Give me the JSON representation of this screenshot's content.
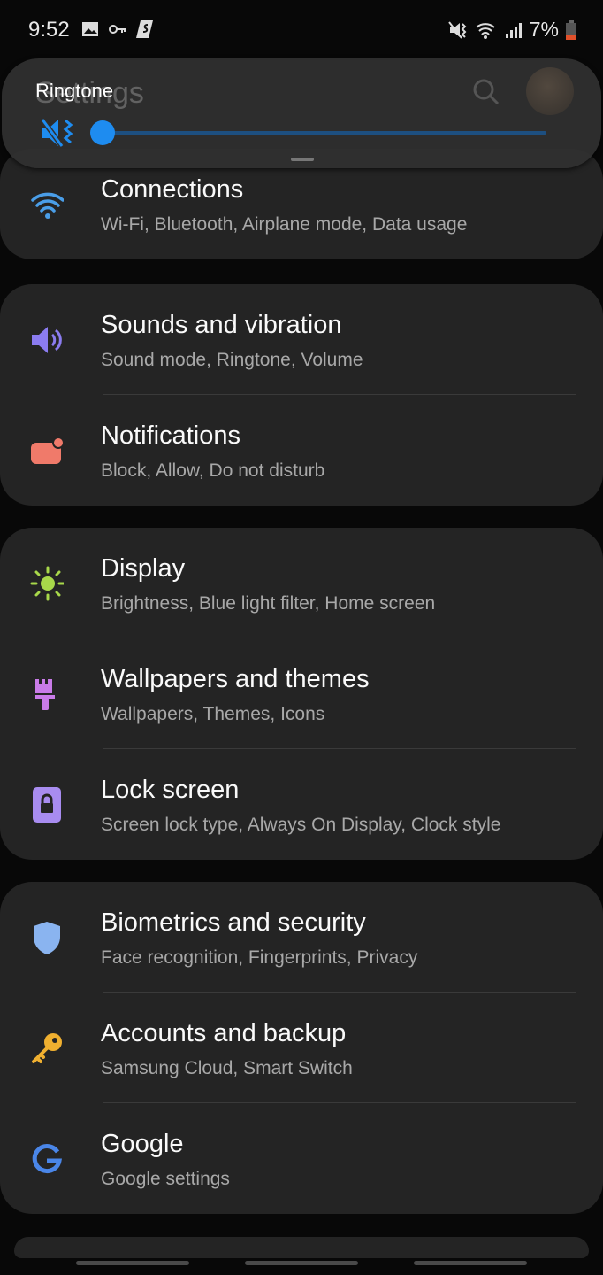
{
  "status_bar": {
    "time": "9:52",
    "battery": "7%",
    "icons": [
      "image-icon",
      "vpn-key-icon",
      "app-s-icon",
      "vibrate-mute-icon",
      "wifi-icon",
      "signal-icon",
      "battery-low-icon"
    ]
  },
  "header": {
    "title": "Settings",
    "icons": [
      "search-icon",
      "avatar"
    ]
  },
  "volume_panel": {
    "label": "Ringtone",
    "level_percent": 0,
    "icon": "vibrate-mute-icon",
    "accent": "#1e8cf0"
  },
  "groups": [
    {
      "items": [
        {
          "title": "Connections",
          "subtitle": "Wi-Fi, Bluetooth, Airplane mode, Data usage",
          "icon": "wifi-icon",
          "color": "#4a9ee8"
        }
      ]
    },
    {
      "items": [
        {
          "title": "Sounds and vibration",
          "subtitle": "Sound mode, Ringtone, Volume",
          "icon": "speaker-icon",
          "color": "#8b7cf0"
        },
        {
          "title": "Notifications",
          "subtitle": "Block, Allow, Do not disturb",
          "icon": "notification-icon",
          "color": "#f07a6a"
        }
      ]
    },
    {
      "items": [
        {
          "title": "Display",
          "subtitle": "Brightness, Blue light filter, Home screen",
          "icon": "sun-icon",
          "color": "#a8d84a"
        },
        {
          "title": "Wallpapers and themes",
          "subtitle": "Wallpapers, Themes, Icons",
          "icon": "brush-icon",
          "color": "#c97be8"
        },
        {
          "title": "Lock screen",
          "subtitle": "Screen lock type, Always On Display, Clock style",
          "icon": "lock-icon",
          "color": "#a88cf0"
        }
      ]
    },
    {
      "items": [
        {
          "title": "Biometrics and security",
          "subtitle": "Face recognition, Fingerprints, Privacy",
          "icon": "shield-icon",
          "color": "#8ab4f0"
        },
        {
          "title": "Accounts and backup",
          "subtitle": "Samsung Cloud, Smart Switch",
          "icon": "key-icon",
          "color": "#f0b030"
        },
        {
          "title": "Google",
          "subtitle": "Google settings",
          "icon": "google-icon",
          "color": "#4a86e8"
        }
      ]
    }
  ]
}
